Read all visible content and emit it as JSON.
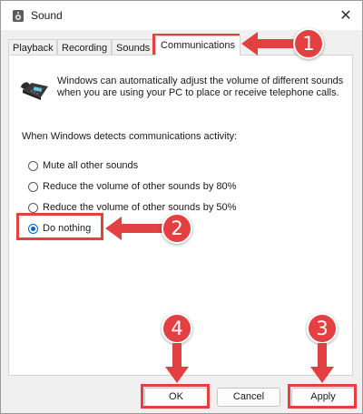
{
  "window": {
    "title": "Sound",
    "close_glyph": "✕"
  },
  "tabs": [
    {
      "label": "Playback",
      "active": false
    },
    {
      "label": "Recording",
      "active": false
    },
    {
      "label": "Sounds",
      "active": false
    },
    {
      "label": "Communications",
      "active": true
    }
  ],
  "panel": {
    "description": "Windows can automatically adjust the volume of different sounds when you are using your PC to place or receive telephone calls.",
    "prompt": "When Windows detects communications activity:",
    "options": [
      {
        "label": "Mute all other sounds",
        "selected": false
      },
      {
        "label": "Reduce the volume of other sounds by 80%",
        "selected": false
      },
      {
        "label": "Reduce the volume of other sounds by 50%",
        "selected": false
      },
      {
        "label": "Do nothing",
        "selected": true
      }
    ]
  },
  "buttons": {
    "ok": "OK",
    "cancel": "Cancel",
    "apply": "Apply"
  },
  "annotations": {
    "step1": "1",
    "step2": "2",
    "step3": "3",
    "step4": "4",
    "color": "#e34141"
  },
  "icons": {
    "window": "speaker-icon",
    "telephone": "telephone-icon"
  }
}
